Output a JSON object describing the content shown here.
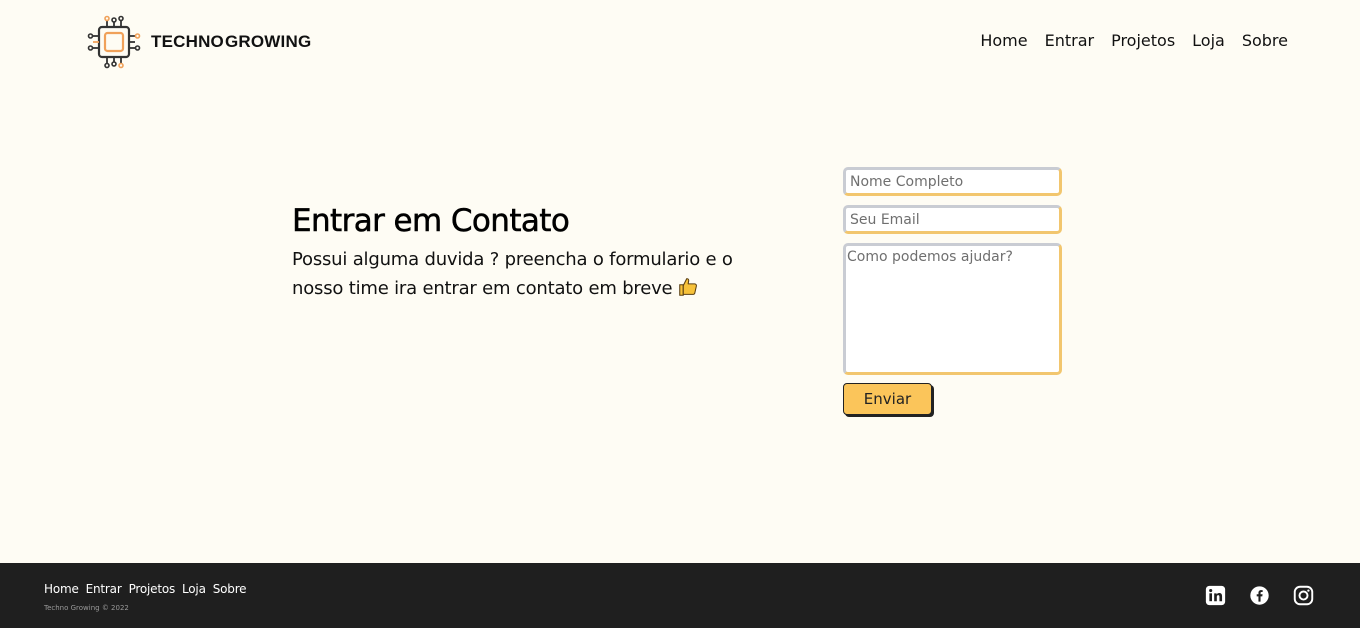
{
  "header": {
    "logo": {
      "text_part1": "TECHNO",
      "text_part2": "GROWING",
      "icon": "circuit-chip-icon"
    },
    "nav": [
      {
        "label": "Home"
      },
      {
        "label": "Entrar"
      },
      {
        "label": "Projetos"
      },
      {
        "label": "Loja"
      },
      {
        "label": "Sobre"
      }
    ]
  },
  "contact": {
    "title": "Entrar em Contato",
    "description": "Possui alguma duvida ? preencha o formulario e o nosso time ira entrar em contato em breve",
    "emoji_icon": "thumbs-up-icon"
  },
  "form": {
    "name_placeholder": "Nome Completo",
    "email_placeholder": "Seu Email",
    "message_placeholder": "Como podemos ajudar?",
    "submit_label": "Enviar"
  },
  "footer": {
    "nav": [
      {
        "label": "Home"
      },
      {
        "label": "Entrar"
      },
      {
        "label": "Projetos"
      },
      {
        "label": "Loja"
      },
      {
        "label": "Sobre"
      }
    ],
    "copyright": "Techno Growing © 2022",
    "socials": [
      "linkedin-icon",
      "facebook-icon",
      "instagram-icon"
    ]
  },
  "colors": {
    "background": "#fefcf4",
    "accent": "#fbc55a",
    "footer_bg": "#1f1f1f",
    "logo_orange": "#f0a15a"
  }
}
